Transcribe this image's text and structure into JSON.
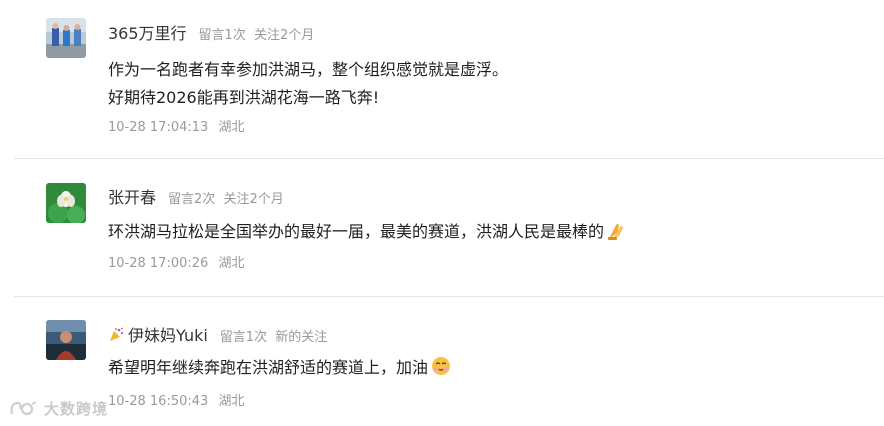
{
  "comments": [
    {
      "username": "365万里行",
      "msg_count": "留言1次",
      "follow": "关注2个月",
      "lines": [
        "作为一名跑者有幸参加洪湖马，整个组织感觉就是虚浮。",
        "好期待2026能再到洪湖花海一路飞奔!"
      ],
      "time": "10-28 17:04:13",
      "location": "湖北"
    },
    {
      "username": "张开春",
      "msg_count": "留言2次",
      "follow": "关注2个月",
      "lines": [
        "环洪湖马拉松是全国举办的最好一届，最美的赛道，洪湖人民是最棒的"
      ],
      "emoji": "praying-hands-emoji",
      "time": "10-28 17:00:26",
      "location": "湖北"
    },
    {
      "username": "伊妹妈Yuki",
      "username_icon": "party-popper-icon",
      "msg_count": "留言1次",
      "follow": "新的关注",
      "lines": [
        "希望明年继续奔跑在洪湖舒适的赛道上，加油"
      ],
      "emoji": "smiling-face-emoji",
      "time": "10-28 16:50:43",
      "location": "湖北"
    }
  ],
  "watermark": "大数跨境",
  "colors": {
    "username": "#353535",
    "meta": "#9a9a9a",
    "body": "#1f1f1f",
    "divider": "#e6e6e6"
  }
}
